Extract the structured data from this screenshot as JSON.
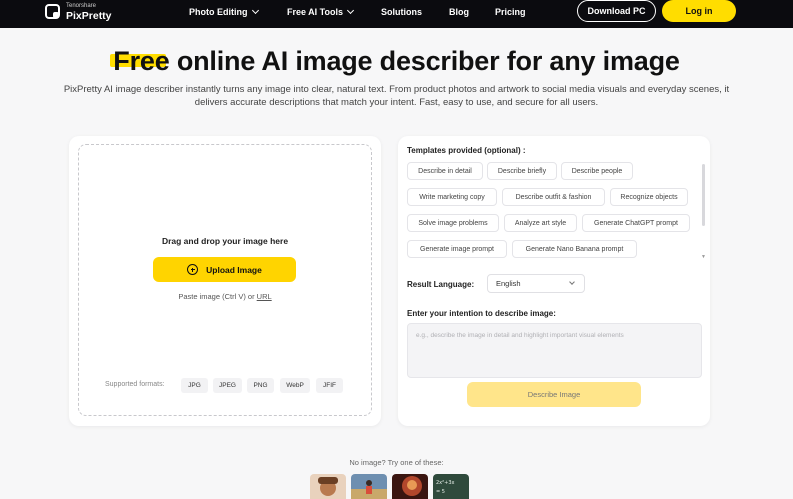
{
  "nav": {
    "brand_top": "Tenorshare",
    "brand_name": "PixPretty",
    "items": [
      {
        "label": "Photo Editing"
      },
      {
        "label": "Free AI Tools"
      },
      {
        "label": "Solutions"
      },
      {
        "label": "Blog"
      },
      {
        "label": "Pricing"
      }
    ],
    "download_label": "Download PC",
    "login_label": "Log in"
  },
  "hero": {
    "title_highlight": "Free",
    "title_rest": " online AI image describer for any image",
    "description": "PixPretty AI image describer instantly turns any image into clear, natural text. From product photos and artwork to social media visuals and everyday scenes, it delivers accurate descriptions that match your intent. Fast, easy to use, and secure for all users."
  },
  "upload": {
    "drag_text": "Drag and drop your image here",
    "button_label": "Upload Image",
    "paste_prefix": "Paste image (Ctrl V) or ",
    "paste_url": "URL",
    "formats_label": "Supported formats:",
    "formats": [
      "JPG",
      "JPEG",
      "PNG",
      "WebP",
      "JFIF"
    ]
  },
  "templates": {
    "label": "Templates provided (optional) :",
    "chips": [
      "Describe in detail",
      "Describe briefly",
      "Describe people",
      "Write marketing copy",
      "Describe outfit & fashion",
      "Recognize objects",
      "Solve image problems",
      "Analyze art style",
      "Generate ChatGPT prompt",
      "Generate image prompt",
      "Generate Nano Banana prompt"
    ]
  },
  "language": {
    "label": "Result Language:",
    "selected": "English"
  },
  "intent": {
    "label": "Enter your intention to describe image:",
    "placeholder": "e.g., describe the image in detail and highlight important visual elements"
  },
  "describe_button": "Describe Image",
  "samples": {
    "label": "No image? Try one of these:",
    "thumb_colors": [
      "#c98d5e",
      "#5c7fa0",
      "#7a2e1f",
      "#2f4a3c"
    ],
    "formula_text": "2x²+3x\n= 5"
  },
  "colors": {
    "accent": "#ffdd00",
    "nav_bg": "#0b0b0f"
  }
}
